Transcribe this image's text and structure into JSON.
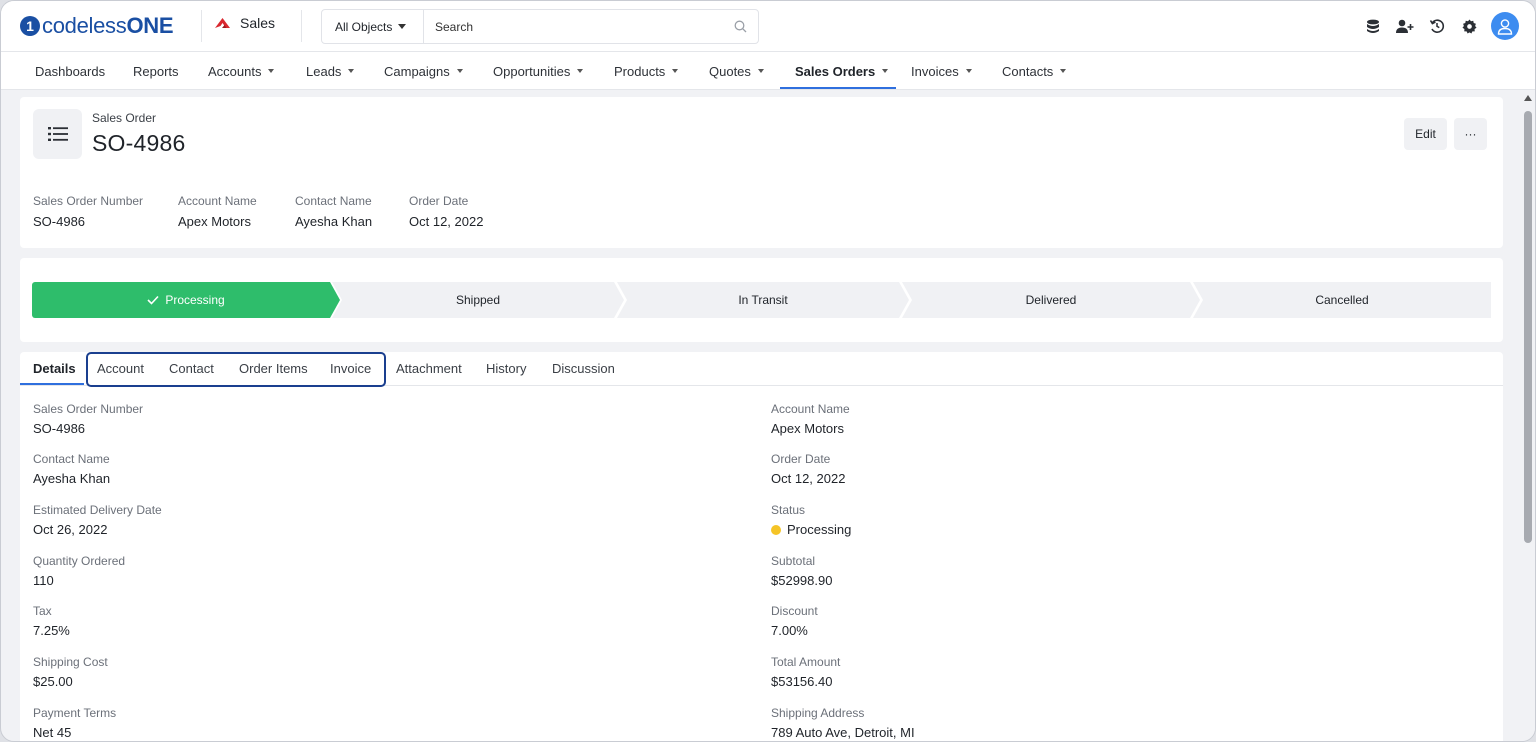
{
  "brand": {
    "name_light": "codeless",
    "name_bold": "ONE",
    "mark": "1"
  },
  "app": {
    "name": "Sales"
  },
  "search": {
    "scope": "All Objects",
    "placeholder": "Search"
  },
  "nav": {
    "items": [
      {
        "label": "Dashboards",
        "dropdown": false
      },
      {
        "label": "Reports",
        "dropdown": false
      },
      {
        "label": "Accounts",
        "dropdown": true
      },
      {
        "label": "Leads",
        "dropdown": true
      },
      {
        "label": "Campaigns",
        "dropdown": true
      },
      {
        "label": "Opportunities",
        "dropdown": true
      },
      {
        "label": "Products",
        "dropdown": true
      },
      {
        "label": "Quotes",
        "dropdown": true
      },
      {
        "label": "Sales Orders",
        "dropdown": true,
        "active": true
      },
      {
        "label": "Invoices",
        "dropdown": true
      },
      {
        "label": "Contacts",
        "dropdown": true
      }
    ]
  },
  "record": {
    "type": "Sales Order",
    "title": "SO-4986",
    "edit_label": "Edit",
    "more_label": "···",
    "highlights": [
      {
        "label": "Sales Order Number",
        "value": "SO-4986"
      },
      {
        "label": "Account Name",
        "value": "Apex Motors"
      },
      {
        "label": "Contact Name",
        "value": "Ayesha Khan"
      },
      {
        "label": "Order Date",
        "value": "Oct 12, 2022"
      }
    ]
  },
  "path": {
    "steps": [
      {
        "label": "Processing",
        "complete": true
      },
      {
        "label": "Shipped",
        "complete": false
      },
      {
        "label": "In Transit",
        "complete": false
      },
      {
        "label": "Delivered",
        "complete": false
      },
      {
        "label": "Cancelled",
        "complete": false
      }
    ]
  },
  "tabs": [
    "Details",
    "Account",
    "Contact",
    "Order Items",
    "Invoice",
    "Attachment",
    "History",
    "Discussion"
  ],
  "details": {
    "left": [
      {
        "label": "Sales Order Number",
        "value": "SO-4986"
      },
      {
        "label": "Contact Name",
        "value": "Ayesha Khan"
      },
      {
        "label": "Estimated Delivery Date",
        "value": "Oct 26, 2022"
      },
      {
        "label": "Quantity Ordered",
        "value": "110"
      },
      {
        "label": "Tax",
        "value": "7.25%"
      },
      {
        "label": "Shipping Cost",
        "value": "$25.00"
      },
      {
        "label": "Payment Terms",
        "value": "Net 45"
      }
    ],
    "right": [
      {
        "label": "Account Name",
        "value": "Apex Motors"
      },
      {
        "label": "Order Date",
        "value": "Oct 12, 2022"
      },
      {
        "label": "Status",
        "value": "Processing",
        "status_color": "#f5c427"
      },
      {
        "label": "Subtotal",
        "value": "$52998.90"
      },
      {
        "label": "Discount",
        "value": "7.00%"
      },
      {
        "label": "Total Amount",
        "value": "$53156.40"
      },
      {
        "label": "Shipping Address",
        "value": "789 Auto Ave, Detroit, MI"
      }
    ]
  },
  "colors": {
    "accent": "#2f6fde",
    "brand": "#1a4fa3",
    "path_complete": "#2ebd6b"
  }
}
